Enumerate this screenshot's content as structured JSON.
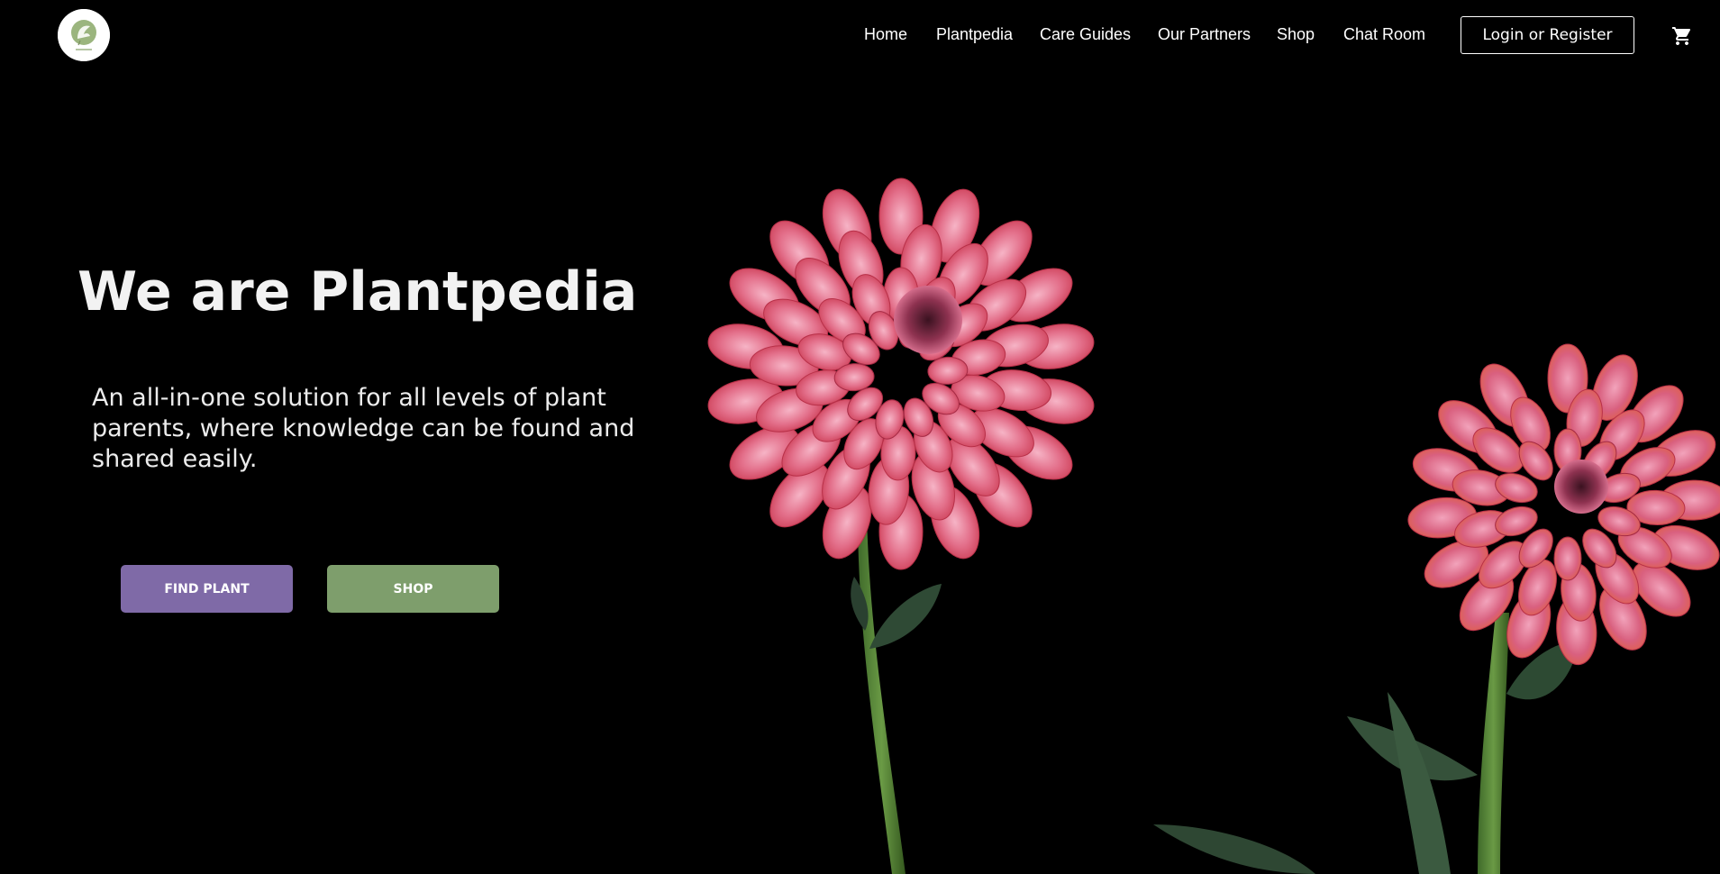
{
  "header": {
    "logo_icon": "plantpedia-logo-icon",
    "nav": [
      {
        "label": "Home"
      },
      {
        "label": "Plantpedia"
      },
      {
        "label": "Care Guides"
      },
      {
        "label": "Our Partners"
      },
      {
        "label": "Shop"
      },
      {
        "label": "Chat Room"
      }
    ],
    "login_label": "Login or Register",
    "cart_icon": "cart-icon"
  },
  "hero": {
    "title": "We are Plantpedia",
    "subtitle": "An all-in-one solution for all levels of plant parents, where knowledge can be found and shared easily.",
    "find_plant_label": "FIND PLANT",
    "shop_label": "SHOP"
  },
  "colors": {
    "background": "#000000",
    "find_button": "#7f6aa7",
    "shop_button": "#7e9e6c",
    "petal": "#d9546c"
  }
}
